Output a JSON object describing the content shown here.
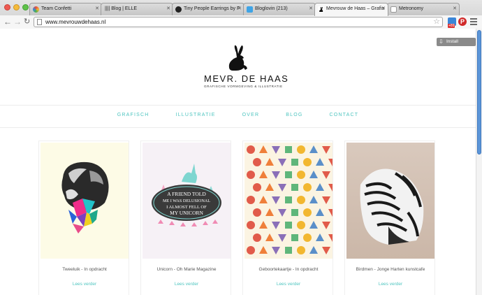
{
  "browser": {
    "tabs": [
      {
        "label": "Team Confetti",
        "active": false
      },
      {
        "label": "|||| Blog | ELLE",
        "active": false
      },
      {
        "label": "Tiny People Earrings by F",
        "active": false
      },
      {
        "label": "Bloglovin (213)",
        "active": false
      },
      {
        "label": "Mevrouw de Haas – Grafis",
        "active": true
      },
      {
        "label": "Metronomy",
        "active": false
      }
    ],
    "url": "www.mevrouwdehaas.nl",
    "extension_badge": "+89"
  },
  "page": {
    "install_theme_label": "Install Theme",
    "brand": {
      "name": "MEVR. DE HAAS",
      "tagline": "GRAFISCHE VORMGEVING & ILLUSTRATIE"
    },
    "nav": [
      "GRAFISCH",
      "ILLUSTRATIE",
      "OVER",
      "BLOG",
      "CONTACT"
    ],
    "cards": [
      {
        "title": "Tweeluik - In opdracht",
        "link": "Lees verder"
      },
      {
        "title": "Unicorn - Oh Marie Magazine",
        "link": "Lees verder",
        "art_text": [
          "A FRIEND TOLD",
          "ME I WAS DELUSIONAL",
          "I ALMOST FELL OF",
          "MY UNICORN"
        ]
      },
      {
        "title": "Geboortekaartje - In opdracht",
        "link": "Lees verder"
      },
      {
        "title": "Birdmen - Jonge Harten kunstcafe",
        "link": "Lees verder"
      }
    ]
  },
  "colors": {
    "accent": "#4fc5c0",
    "scroll_thumb": "#5b95d8"
  }
}
